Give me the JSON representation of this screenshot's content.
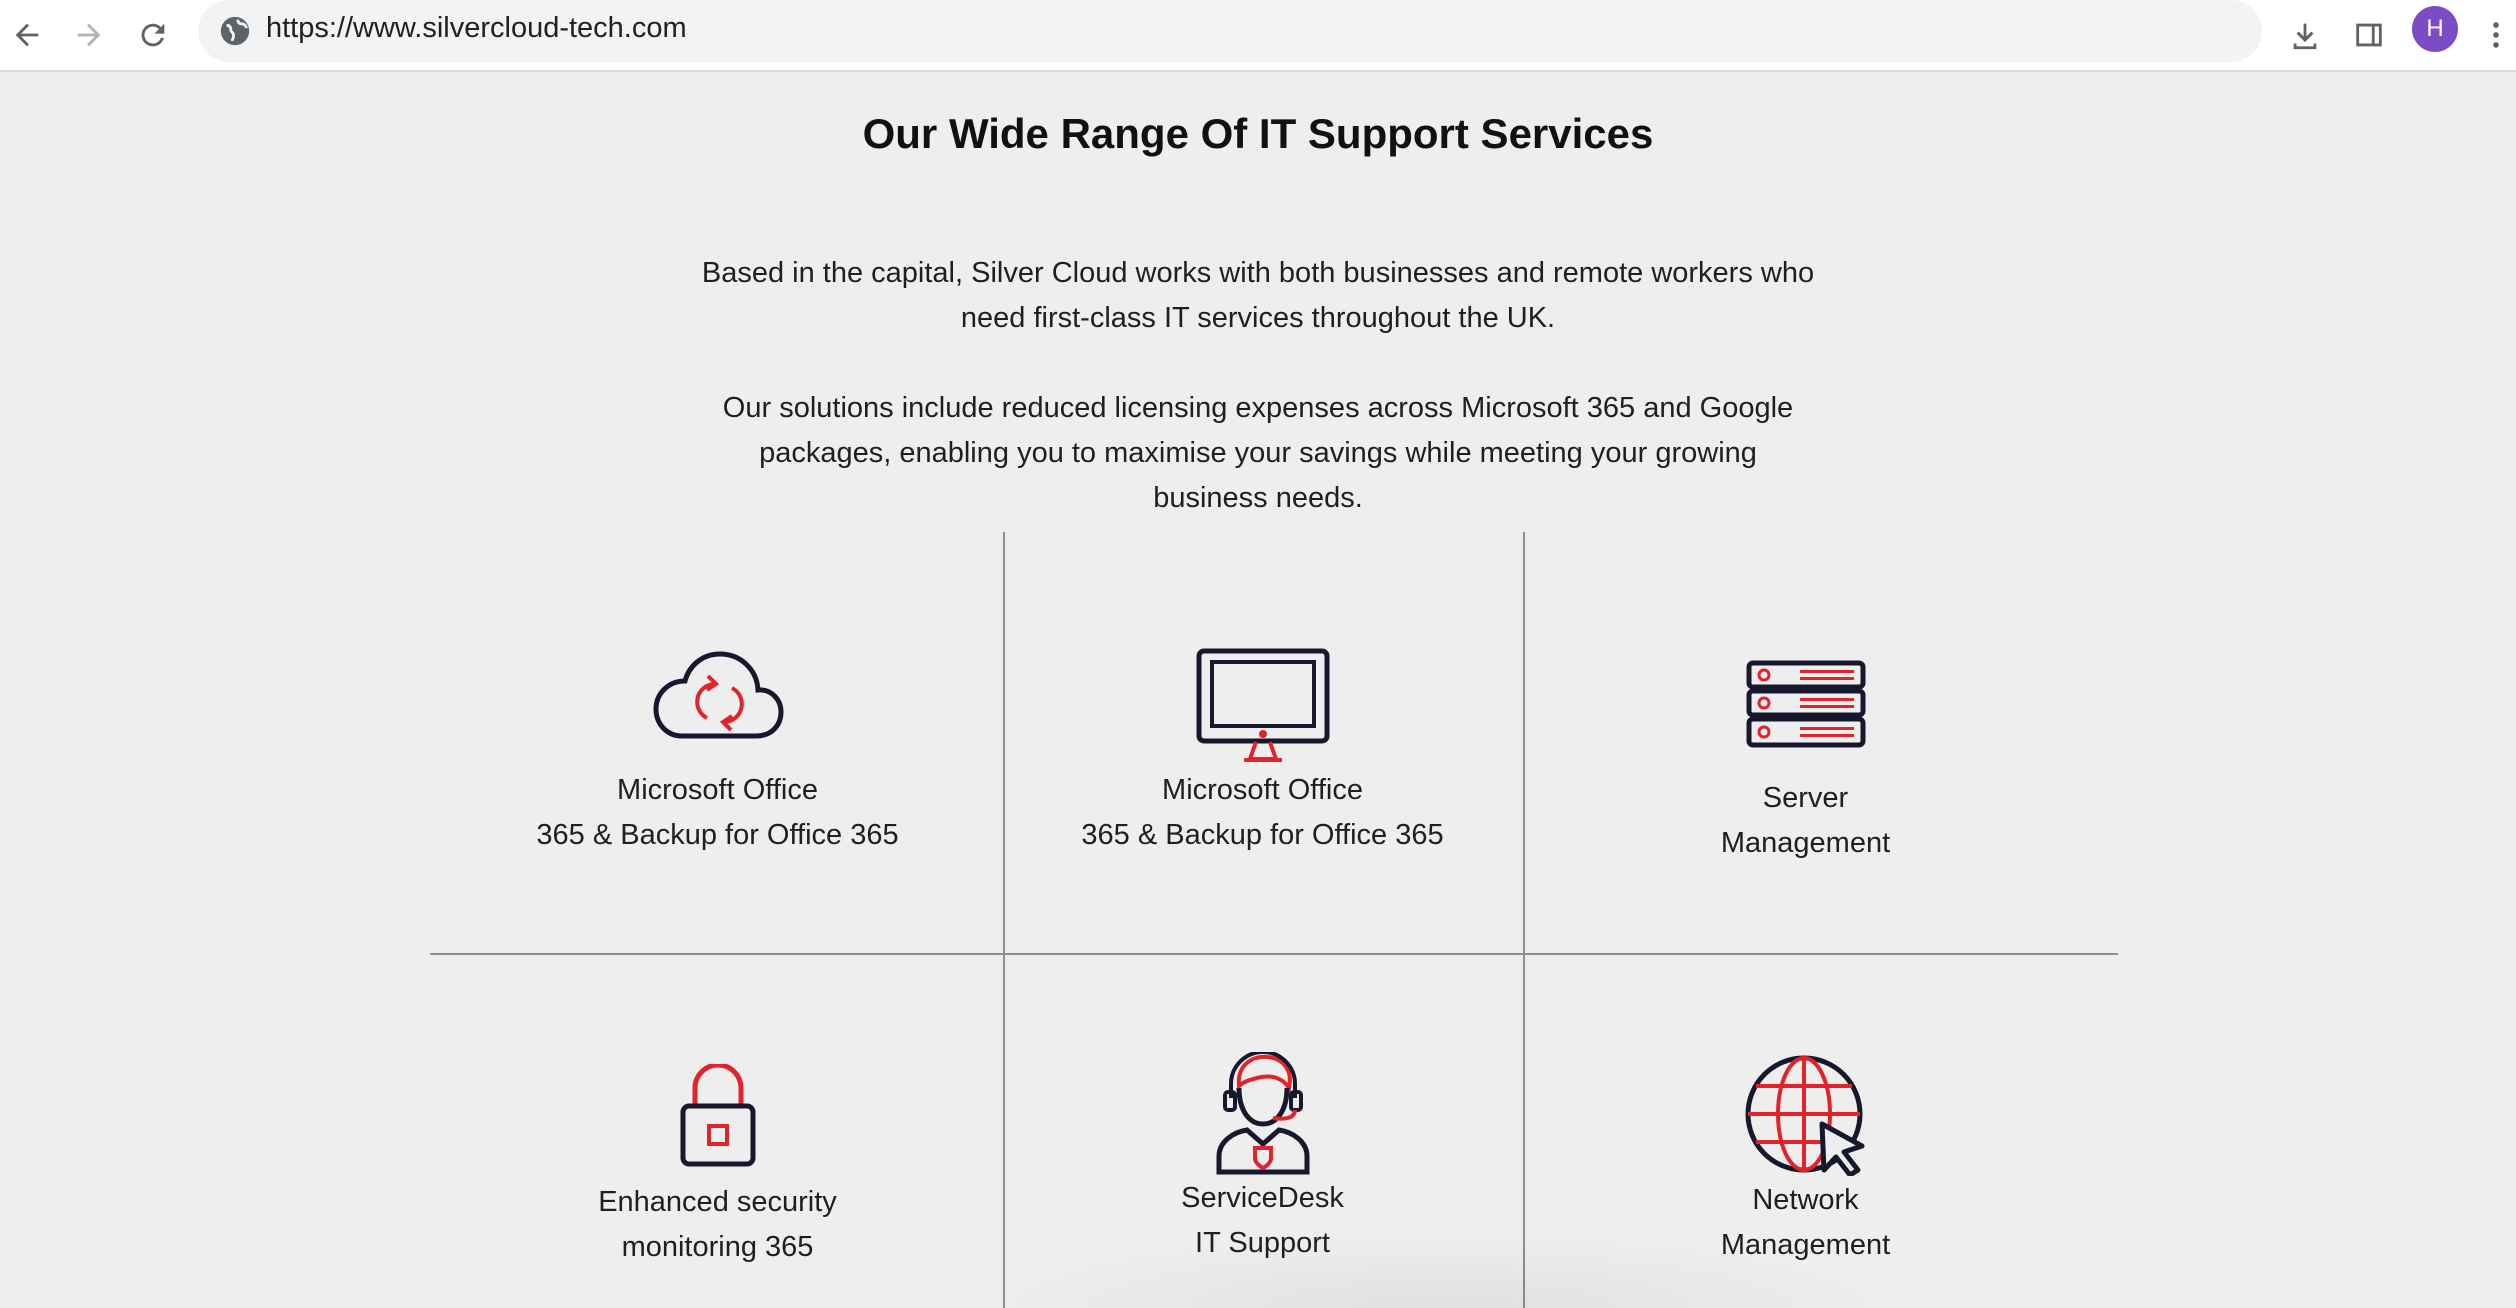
{
  "browser": {
    "url": "https://www.silvercloud-tech.com",
    "profile_initial": "H"
  },
  "page": {
    "title": "Our Wide Range Of IT Support Services",
    "intro_1_line1": "Based in the capital, Silver Cloud works with both businesses and remote workers who",
    "intro_1_line2": "need first-class IT services throughout the UK.",
    "intro_2_line1": "Our solutions include reduced licensing expenses across Microsoft 365 and Google",
    "intro_2_line2": "packages, enabling you to maximise your savings while meeting your growing",
    "intro_2_line3": "business needs."
  },
  "services": [
    {
      "line1": "Microsoft Office",
      "line2": "365 & Backup for Office 365",
      "icon": "cloud-sync-icon"
    },
    {
      "line1": "Microsoft Office",
      "line2": "365 & Backup for Office 365",
      "icon": "monitor-icon"
    },
    {
      "line1": "Server",
      "line2": "Management",
      "icon": "server-icon"
    },
    {
      "line1": "Enhanced security",
      "line2": "monitoring 365",
      "icon": "padlock-icon"
    },
    {
      "line1": "ServiceDesk",
      "line2": "IT Support",
      "icon": "support-agent-icon"
    },
    {
      "line1": "Network",
      "line2": "Management",
      "icon": "globe-cursor-icon"
    }
  ],
  "colors": {
    "accent_red": "#e2232a",
    "icon_navy": "#16182d",
    "background": "#eeeeee"
  }
}
